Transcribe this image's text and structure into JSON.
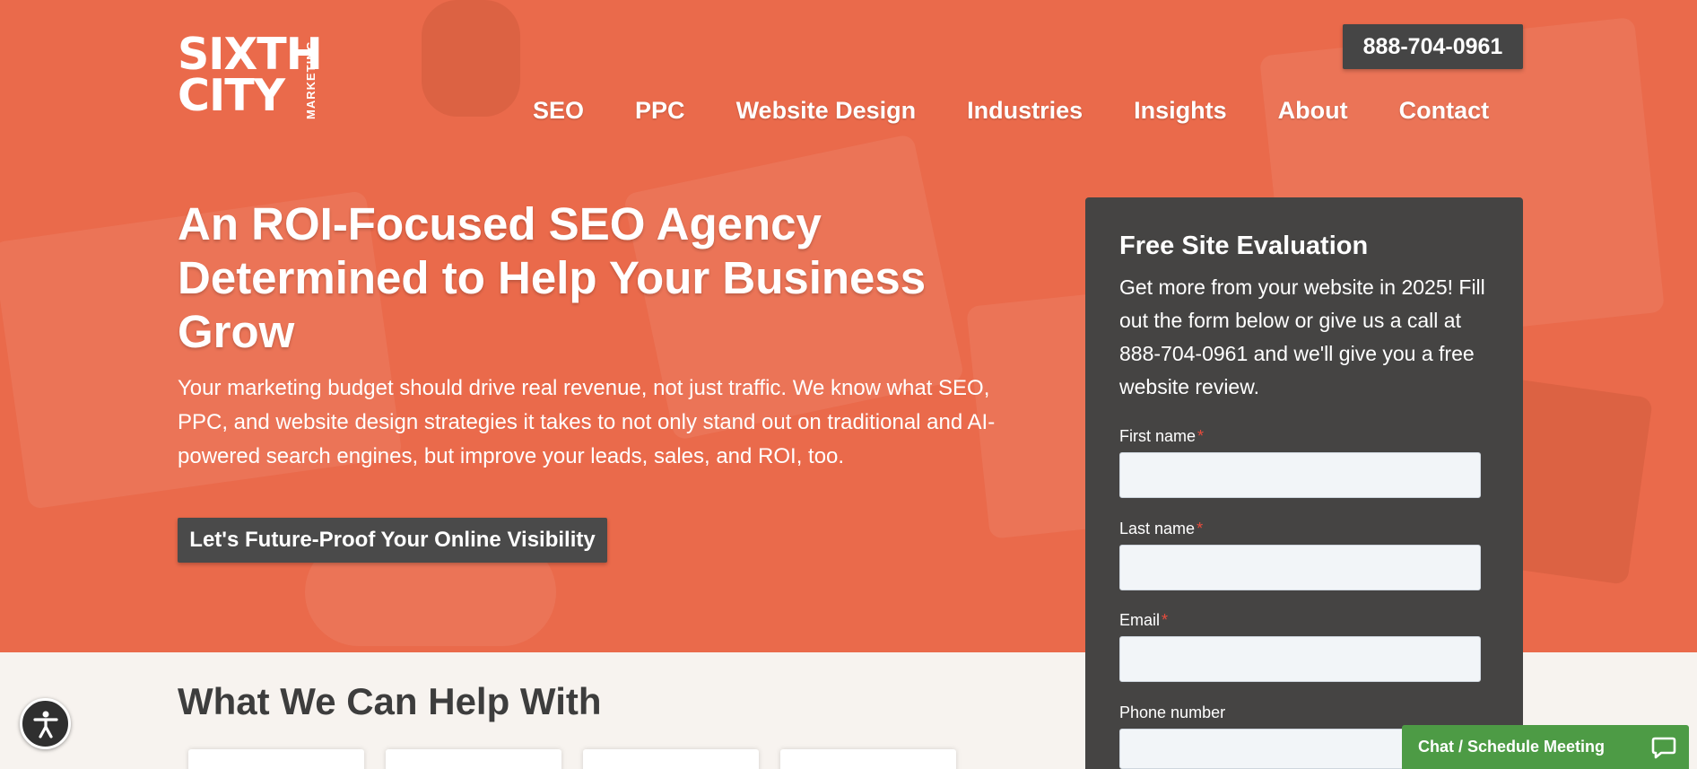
{
  "logo": {
    "line1": "SIXTH",
    "line2": "CITY",
    "tag": "MARKETING"
  },
  "header": {
    "phone": "888-704-0961"
  },
  "nav": {
    "items": [
      {
        "label": "SEO"
      },
      {
        "label": "PPC"
      },
      {
        "label": "Website Design"
      },
      {
        "label": "Industries"
      },
      {
        "label": "Insights"
      },
      {
        "label": "About"
      },
      {
        "label": "Contact"
      }
    ]
  },
  "hero": {
    "headline": "An ROI-Focused SEO Agency Determined to Help Your Business Grow",
    "subcopy": "Your marketing budget should drive real revenue, not just traffic. We know what SEO, PPC, and website design strategies it takes to not only stand out on traditional and AI-powered search engines, but improve your leads, sales, and ROI, too.",
    "cta": "Let's Future-Proof Your Online Visibility"
  },
  "form": {
    "title": "Free Site Evaluation",
    "description": "Get more from your website in 2025! Fill out the form below or give us a call at 888-704-0961 and we'll give you a free website review.",
    "fields": [
      {
        "label": "First name",
        "required": "*"
      },
      {
        "label": "Last name",
        "required": "*"
      },
      {
        "label": "Email",
        "required": "*"
      },
      {
        "label": "Phone number",
        "required": ""
      }
    ]
  },
  "section": {
    "title": "What We Can Help With"
  },
  "chat": {
    "label": "Chat / Schedule Meeting",
    "icon": "chat-bubble-icon"
  },
  "accessibility": {
    "icon": "accessibility-icon"
  },
  "colors": {
    "hero": "#ea6a4b",
    "dark": "#454545",
    "chat": "#4d9b45"
  }
}
